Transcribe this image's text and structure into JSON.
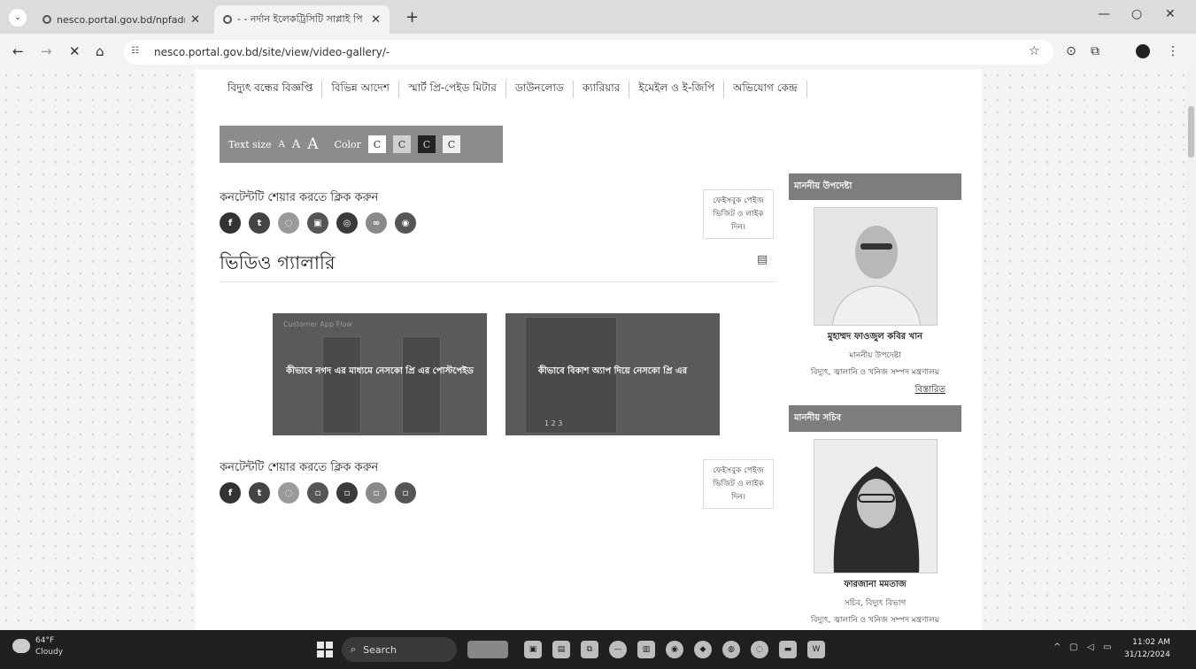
{
  "browser": {
    "tabs": [
      {
        "title": "nesco.portal.gov.bd/npfadmin",
        "active": false
      },
      {
        "title": "- - নর্দান ইলেকট্রিসিটি সাপ্লাই পি",
        "active": true
      }
    ],
    "url": "nesco.portal.gov.bd/site/view/video-gallery/-"
  },
  "menu": {
    "items": [
      "বিদ্যুৎ বন্ধের বিজ্ঞপ্তি",
      "বিভিন্ন আদেশ",
      "স্মার্ট প্রি-পেইড মিটার",
      "ডাউনলোড",
      "ক্যারিয়ার",
      "ইমেইল ও ই-জিপি",
      "অভিযোগ কেন্দ্র"
    ]
  },
  "a11y": {
    "text_size_label": "Text size",
    "size_small": "A",
    "size_medium": "A",
    "size_large": "A",
    "color_label": "Color",
    "swatches": [
      "C",
      "C",
      "C",
      "C"
    ],
    "swatch_colors": [
      "#ffffff",
      "#d0d0d0",
      "#222222",
      "#f0f0f0"
    ]
  },
  "share": {
    "title": "কনটেন্টটি শেয়ার করতে ক্লিক করুন",
    "icons": [
      "facebook-icon",
      "twitter-icon",
      "whatsapp-icon",
      "linkedin-icon",
      "email-icon",
      "link-icon",
      "messenger-icon"
    ],
    "glyphs_top": [
      "f",
      "t",
      "◌",
      "▣",
      "◎",
      "∞",
      "◉"
    ],
    "glyphs_bottom": [
      "f",
      "t",
      "◌",
      "▫",
      "▫",
      "▫",
      "▫"
    ],
    "colors": [
      "#333333",
      "#444444",
      "#9a9a9a",
      "#555555",
      "#3a3a3a",
      "#8a8a8a",
      "#555555"
    ]
  },
  "fb_box": {
    "line1": "ফেইসবুক পেইজ",
    "line2": "ভিজিট ও লাইক",
    "line3": "দিন।"
  },
  "page_title": "ভিডিও গ্যালারি",
  "videos": [
    {
      "caption": "কীভাবে নগদ এর মাধ্যমে নেসকো প্রি এর পোস্টপেইড",
      "small_text": "Customer App Flow"
    },
    {
      "caption": "কীভাবে বিকাশ অ্যাপ দিয়ে নেসকো প্রি এর",
      "small_text": "1  2  3"
    }
  ],
  "sidebar": {
    "advisor": {
      "heading": "মাননীয় উপদেষ্টা",
      "name": "মুহাম্মদ ফাওজুল কবির খান",
      "designation": "মাননীয় উপদেষ্টা",
      "ministry": "বিদ্যুৎ, জ্বালানি ও খনিজ সম্পদ মন্ত্রণালয়",
      "more": "বিস্তারিত"
    },
    "secretary": {
      "heading": "মাননীয় সচিব",
      "name": "ফারজানা মমতাজ",
      "designation": "সচিব, বিদ্যুৎ বিভাগ",
      "ministry": "বিদ্যুৎ, জ্বালানি ও খনিজ সম্পদ মন্ত্রণালয়"
    }
  },
  "taskbar": {
    "temp": "64°F",
    "weather": "Cloudy",
    "search": "Search",
    "time": "11:02 AM",
    "date": "31/12/2024"
  }
}
